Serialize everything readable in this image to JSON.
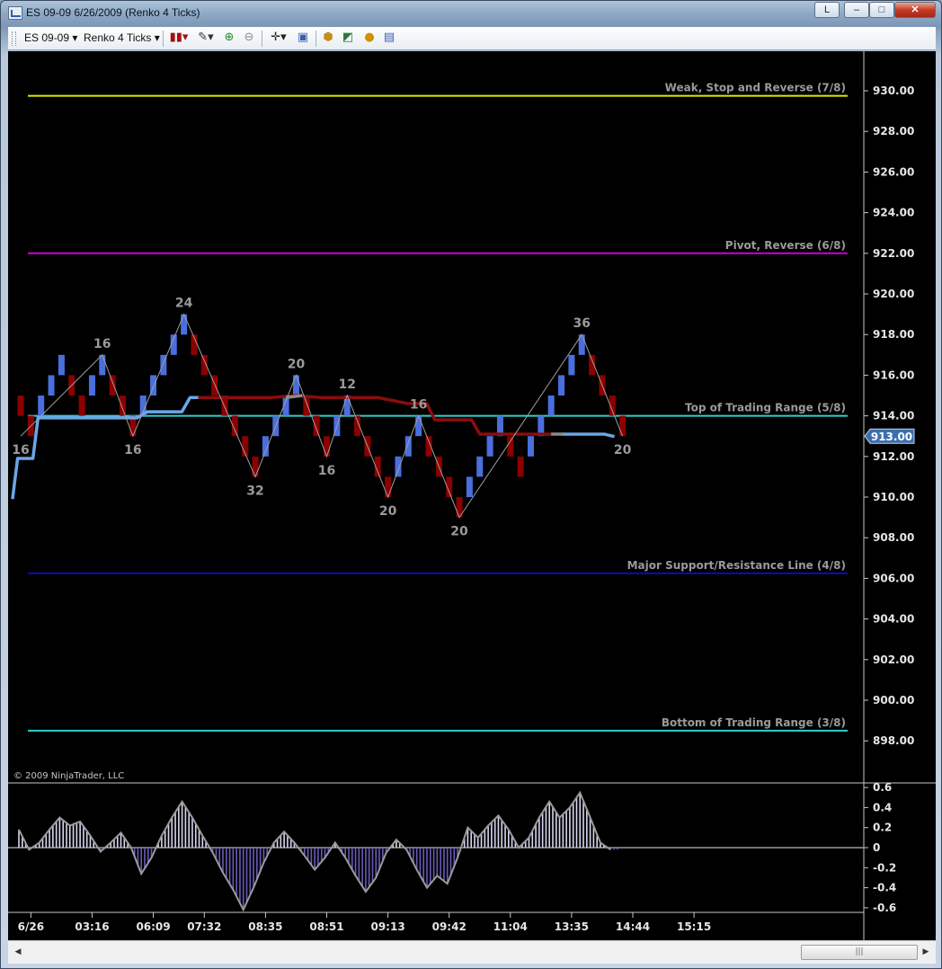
{
  "window": {
    "title": "ES 09-09  6/26/2009 (Renko 4 Ticks)",
    "layout_button": "L",
    "minimize": "–",
    "maximize": "□",
    "close": "✕"
  },
  "toolbar": {
    "instrument": "ES 09-09",
    "chart_type": "Renko 4 Ticks",
    "icons": [
      "bar-style-icon",
      "drawing-pencil-icon",
      "zoom-in-icon",
      "zoom-out-icon",
      "crosshair-icon",
      "properties-icon",
      "strategies-icon",
      "indicators-icon",
      "data-box-icon",
      "chart-trader-icon"
    ]
  },
  "scrollbar": {
    "thumb_grip": "|||"
  },
  "colors": {
    "bg": "#000000",
    "renko_up": "#4a6fdc",
    "renko_down": "#8b0000",
    "hline_weak": "#e6e600",
    "hline_pivot": "#d000d0",
    "hline_top": "#30d0d0",
    "hline_major": "#0a10b0",
    "hline_bottom": "#30d0d0",
    "line_blue": "#6aa6e8",
    "line_red": "#8b0d0d",
    "line_gray": "#8a8a8a",
    "current_price_bg": "#3c6fb0",
    "osc_pos": "#d6d6f0",
    "osc_neg": "#6a5ab8",
    "zigzag": "#a0a0a0"
  },
  "chart_data": {
    "type": "renko",
    "copyright": "© 2009 NinjaTrader, LLC",
    "ylim": [
      897,
      931
    ],
    "price_ticks": [
      "930.00",
      "928.00",
      "926.00",
      "924.00",
      "922.00",
      "920.00",
      "918.00",
      "916.00",
      "914.00",
      "912.00",
      "910.00",
      "908.00",
      "906.00",
      "904.00",
      "902.00",
      "900.00",
      "898.00"
    ],
    "current_price": "913.00",
    "time_labels": [
      {
        "label": "6/26",
        "i": 1
      },
      {
        "label": "03:16",
        "i": 7
      },
      {
        "label": "06:09",
        "i": 13
      },
      {
        "label": "07:32",
        "i": 18
      },
      {
        "label": "08:35",
        "i": 24
      },
      {
        "label": "08:51",
        "i": 30
      },
      {
        "label": "09:13",
        "i": 36
      },
      {
        "label": "09:42",
        "i": 42
      },
      {
        "label": "11:04",
        "i": 48
      },
      {
        "label": "13:35",
        "i": 54
      },
      {
        "label": "14:44",
        "i": 60
      },
      {
        "label": "15:15",
        "i": 66
      }
    ],
    "horizontal_lines": [
      {
        "label": "Weak, Stop and Reverse (7/8)",
        "price": 929.75,
        "color_key": "hline_weak"
      },
      {
        "label": "Pivot, Reverse (6/8)",
        "price": 922.0,
        "color_key": "hline_pivot"
      },
      {
        "label": "Top of Trading Range (5/8)",
        "price": 914.0,
        "color_key": "hline_top"
      },
      {
        "label": "Major Support/Resistance Line (4/8)",
        "price": 906.25,
        "color_key": "hline_major"
      },
      {
        "label": "Bottom of Trading Range (3/8)",
        "price": 898.5,
        "color_key": "hline_bottom"
      }
    ],
    "renko": [
      {
        "o": 915,
        "c": 914
      },
      {
        "o": 914,
        "c": 913
      },
      {
        "o": 914,
        "c": 915
      },
      {
        "o": 915,
        "c": 916
      },
      {
        "o": 916,
        "c": 917
      },
      {
        "o": 916,
        "c": 915
      },
      {
        "o": 915,
        "c": 914
      },
      {
        "o": 915,
        "c": 916
      },
      {
        "o": 916,
        "c": 917
      },
      {
        "o": 916,
        "c": 915
      },
      {
        "o": 915,
        "c": 914
      },
      {
        "o": 914,
        "c": 913
      },
      {
        "o": 914,
        "c": 915
      },
      {
        "o": 915,
        "c": 916
      },
      {
        "o": 916,
        "c": 917
      },
      {
        "o": 917,
        "c": 918
      },
      {
        "o": 918,
        "c": 919
      },
      {
        "o": 918,
        "c": 917
      },
      {
        "o": 917,
        "c": 916
      },
      {
        "o": 916,
        "c": 915
      },
      {
        "o": 915,
        "c": 914
      },
      {
        "o": 914,
        "c": 913
      },
      {
        "o": 913,
        "c": 912
      },
      {
        "o": 912,
        "c": 911
      },
      {
        "o": 912,
        "c": 913
      },
      {
        "o": 913,
        "c": 914
      },
      {
        "o": 914,
        "c": 915
      },
      {
        "o": 915,
        "c": 916
      },
      {
        "o": 915,
        "c": 914
      },
      {
        "o": 914,
        "c": 913
      },
      {
        "o": 913,
        "c": 912
      },
      {
        "o": 913,
        "c": 914
      },
      {
        "o": 914,
        "c": 915
      },
      {
        "o": 914,
        "c": 913
      },
      {
        "o": 913,
        "c": 912
      },
      {
        "o": 912,
        "c": 911
      },
      {
        "o": 911,
        "c": 910
      },
      {
        "o": 911,
        "c": 912
      },
      {
        "o": 912,
        "c": 913
      },
      {
        "o": 913,
        "c": 914
      },
      {
        "o": 913,
        "c": 912
      },
      {
        "o": 912,
        "c": 911
      },
      {
        "o": 911,
        "c": 910
      },
      {
        "o": 910,
        "c": 909
      },
      {
        "o": 910,
        "c": 911
      },
      {
        "o": 911,
        "c": 912
      },
      {
        "o": 912,
        "c": 913
      },
      {
        "o": 913,
        "c": 914
      },
      {
        "o": 913,
        "c": 912
      },
      {
        "o": 912,
        "c": 911
      },
      {
        "o": 912,
        "c": 913
      },
      {
        "o": 913,
        "c": 914
      },
      {
        "o": 914,
        "c": 915
      },
      {
        "o": 915,
        "c": 916
      },
      {
        "o": 916,
        "c": 917
      },
      {
        "o": 917,
        "c": 918
      },
      {
        "o": 917,
        "c": 916
      },
      {
        "o": 916,
        "c": 915
      },
      {
        "o": 915,
        "c": 914
      },
      {
        "o": 914,
        "c": 913
      }
    ],
    "renko_x_index_start": 0,
    "zigzag": [
      {
        "i": 0,
        "p": 913,
        "label": "16",
        "pos": "below"
      },
      {
        "i": 8,
        "p": 917,
        "label": "16",
        "pos": "above"
      },
      {
        "i": 11,
        "p": 913,
        "label": "16",
        "pos": "below"
      },
      {
        "i": 16,
        "p": 919,
        "label": "24",
        "pos": "above"
      },
      {
        "i": 23,
        "p": 911,
        "label": "32",
        "pos": "below"
      },
      {
        "i": 27,
        "p": 916,
        "label": "20",
        "pos": "above"
      },
      {
        "i": 30,
        "p": 912,
        "label": "16",
        "pos": "below"
      },
      {
        "i": 32,
        "p": 915,
        "label": "12",
        "pos": "above"
      },
      {
        "i": 36,
        "p": 910,
        "label": "20",
        "pos": "below"
      },
      {
        "i": 39,
        "p": 914,
        "label": "16",
        "pos": "above"
      },
      {
        "i": 43,
        "p": 909,
        "label": "20",
        "pos": "below"
      },
      {
        "i": 55,
        "p": 918,
        "label": "36",
        "pos": "above"
      },
      {
        "i": 59,
        "p": 913,
        "label": "20",
        "pos": "below"
      }
    ],
    "blue_line": [
      [
        -0.8,
        909.9
      ],
      [
        -0.3,
        911.9
      ],
      [
        1.2,
        911.9
      ],
      [
        1.7,
        913.9
      ],
      [
        11.4,
        913.9
      ],
      [
        12.4,
        914.2
      ],
      [
        15.8,
        914.2
      ],
      [
        16.6,
        914.9
      ],
      [
        17.4,
        914.9
      ]
    ],
    "red_line": [
      [
        17.4,
        914.9
      ],
      [
        24.6,
        914.9
      ],
      [
        27.0,
        915.0
      ],
      [
        29.4,
        914.9
      ],
      [
        35.0,
        914.9
      ],
      [
        38.0,
        914.6
      ],
      [
        39.8,
        914.6
      ],
      [
        40.6,
        913.8
      ],
      [
        44.2,
        913.8
      ],
      [
        45.0,
        913.1
      ],
      [
        52.2,
        913.1
      ]
    ],
    "gray_line": [
      [
        26.0,
        914.9
      ],
      [
        27.6,
        915.0
      ],
      [
        52.0,
        913.1
      ],
      [
        53.0,
        913.1
      ]
    ],
    "blue_line2": [
      [
        53.0,
        913.1
      ],
      [
        57.2,
        913.1
      ],
      [
        58.2,
        912.98
      ]
    ],
    "oscillator": {
      "ylim": [
        -0.65,
        0.6
      ],
      "ticks": [
        "0.6",
        "0.4",
        "0.2",
        "0",
        "-0.2",
        "-0.4",
        "-0.6"
      ],
      "values": [
        0.18,
        -0.02,
        0.05,
        0.18,
        0.3,
        0.22,
        0.26,
        0.12,
        -0.04,
        0.05,
        0.15,
        0.0,
        -0.26,
        -0.1,
        0.12,
        0.3,
        0.46,
        0.3,
        0.12,
        -0.05,
        -0.25,
        -0.42,
        -0.62,
        -0.4,
        -0.15,
        0.05,
        0.16,
        0.05,
        -0.08,
        -0.22,
        -0.1,
        0.05,
        -0.1,
        -0.28,
        -0.44,
        -0.3,
        -0.05,
        0.08,
        -0.02,
        -0.22,
        -0.4,
        -0.28,
        -0.36,
        -0.1,
        0.2,
        0.1,
        0.22,
        0.32,
        0.18,
        0.0,
        0.1,
        0.3,
        0.46,
        0.3,
        0.4,
        0.55,
        0.3,
        0.05,
        -0.02
      ]
    }
  }
}
